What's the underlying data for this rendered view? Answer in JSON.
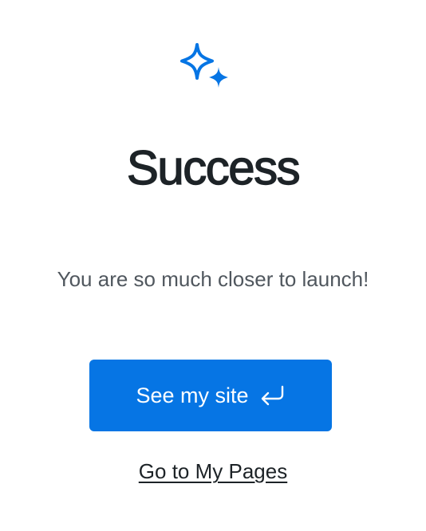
{
  "heading": {
    "title": "Success",
    "icon": "sparkles-icon",
    "icon_color": "#0675e4"
  },
  "message": "You are so much closer to launch!",
  "actions": {
    "primary_label": "See my site",
    "primary_icon": "enter-return-icon",
    "primary_color": "#0675e4",
    "secondary_label": "Go to My Pages"
  }
}
